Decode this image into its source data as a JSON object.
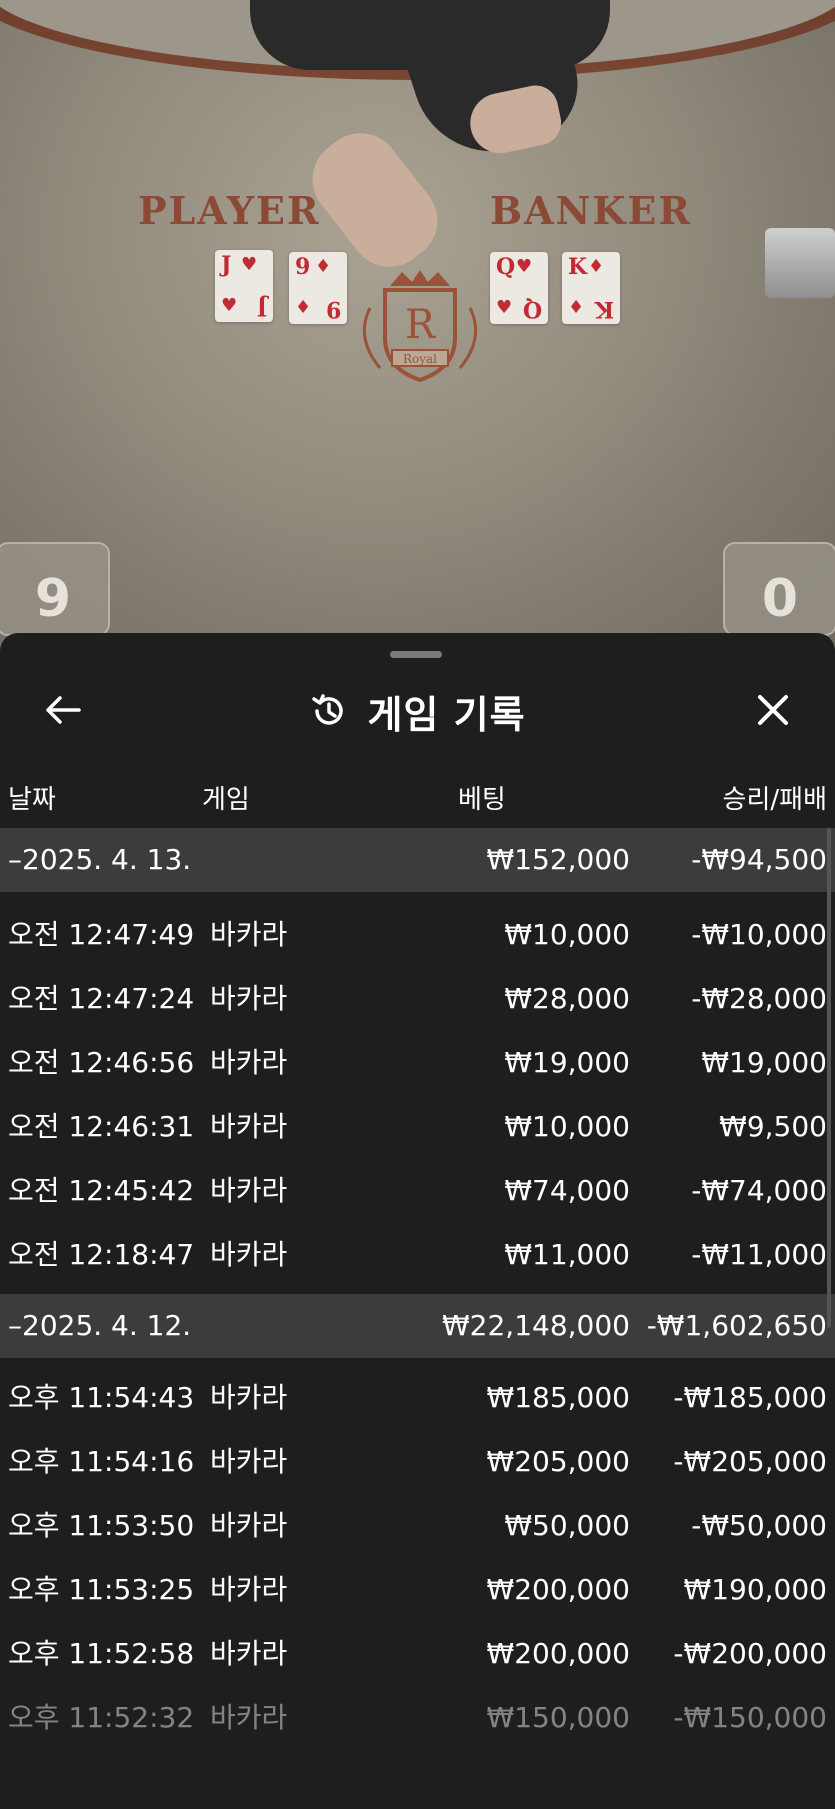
{
  "video": {
    "player_label": "PLAYER",
    "banker_label": "BANKER",
    "player_cards": [
      {
        "rank": "J",
        "suit": "♥"
      },
      {
        "rank": "9",
        "suit": "♦"
      }
    ],
    "banker_cards": [
      {
        "rank": "Q",
        "suit": "♥"
      },
      {
        "rank": "K",
        "suit": "♦"
      }
    ],
    "crest_letter": "R",
    "crest_text": "Royal",
    "player_score": "9",
    "banker_score": "0"
  },
  "header": {
    "title": "게임 기록",
    "back_icon": "arrow-left-icon",
    "history_icon": "history-icon",
    "close_icon": "close-icon"
  },
  "columns": {
    "date": "날짜",
    "game": "게임",
    "bet": "베팅",
    "result": "승리/패배"
  },
  "groups": [
    {
      "date": "–2025. 4. 13.",
      "bet": "₩152,000",
      "result": "-₩94,500",
      "rows": [
        {
          "time": "오전 12:47:49",
          "game": "바카라",
          "bet": "₩10,000",
          "result": "-₩10,000"
        },
        {
          "time": "오전 12:47:24",
          "game": "바카라",
          "bet": "₩28,000",
          "result": "-₩28,000"
        },
        {
          "time": "오전 12:46:56",
          "game": "바카라",
          "bet": "₩19,000",
          "result": "₩19,000"
        },
        {
          "time": "오전 12:46:31",
          "game": "바카라",
          "bet": "₩10,000",
          "result": "₩9,500"
        },
        {
          "time": "오전 12:45:42",
          "game": "바카라",
          "bet": "₩74,000",
          "result": "-₩74,000"
        },
        {
          "time": "오전 12:18:47",
          "game": "바카라",
          "bet": "₩11,000",
          "result": "-₩11,000"
        }
      ]
    },
    {
      "date": "–2025. 4. 12.",
      "bet": "₩22,148,000",
      "result": "-₩1,602,650",
      "rows": [
        {
          "time": "오후 11:54:43",
          "game": "바카라",
          "bet": "₩185,000",
          "result": "-₩185,000"
        },
        {
          "time": "오후 11:54:16",
          "game": "바카라",
          "bet": "₩205,000",
          "result": "-₩205,000"
        },
        {
          "time": "오후 11:53:50",
          "game": "바카라",
          "bet": "₩50,000",
          "result": "-₩50,000"
        },
        {
          "time": "오후 11:53:25",
          "game": "바카라",
          "bet": "₩200,000",
          "result": "₩190,000"
        },
        {
          "time": "오후 11:52:58",
          "game": "바카라",
          "bet": "₩200,000",
          "result": "-₩200,000"
        },
        {
          "time": "오후 11:52:32",
          "game": "바카라",
          "bet": "₩150,000",
          "result": "-₩150,000"
        }
      ]
    }
  ]
}
